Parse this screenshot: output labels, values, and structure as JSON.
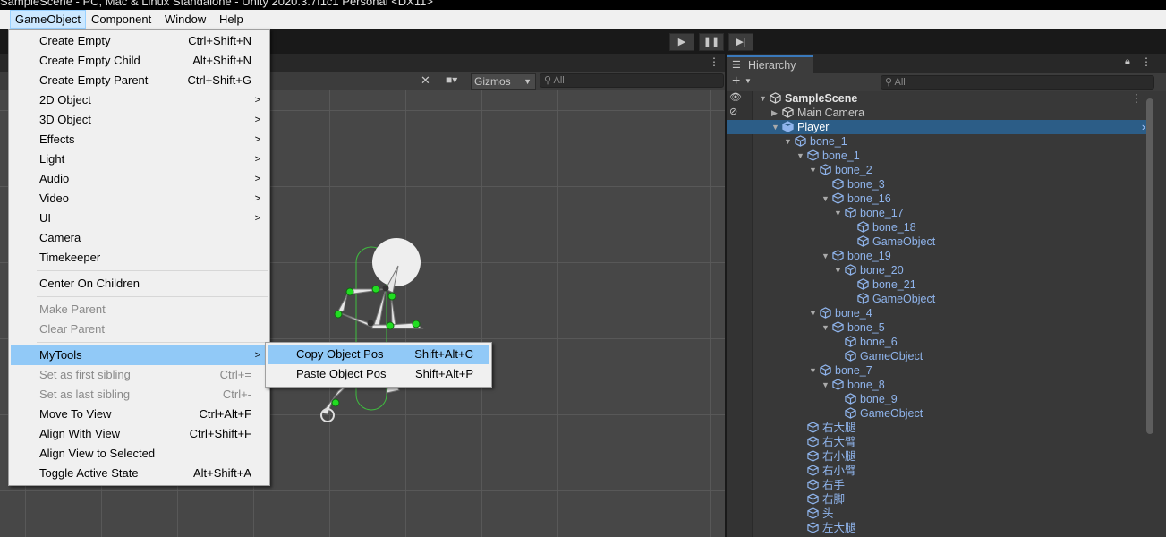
{
  "window": {
    "title": "SampleScene - PC, Mac & Linux Standalone - Unity 2020.3.7f1c1 Personal <DX11>"
  },
  "menubar": {
    "items": [
      "GameObject",
      "Component",
      "Window",
      "Help"
    ]
  },
  "toolbar": {
    "play": "▶",
    "pause": "❚❚",
    "step": "▶|"
  },
  "scene": {
    "gizmos_label": "Gizmos",
    "search_placeholder": "All"
  },
  "hierarchy": {
    "tab_label": "Hierarchy",
    "add_label": "+",
    "search_placeholder": "All",
    "rows": [
      {
        "label": "SampleScene",
        "depth": 0,
        "arrow": "down",
        "type": "scene"
      },
      {
        "label": "Main Camera",
        "depth": 1,
        "arrow": "right",
        "type": "object"
      },
      {
        "label": "Player",
        "depth": 1,
        "arrow": "down",
        "type": "prefab",
        "selected": true
      },
      {
        "label": "bone_1",
        "depth": 2,
        "arrow": "down",
        "type": "prefab"
      },
      {
        "label": "bone_1",
        "depth": 3,
        "arrow": "down",
        "type": "prefab"
      },
      {
        "label": "bone_2",
        "depth": 4,
        "arrow": "down",
        "type": "prefab"
      },
      {
        "label": "bone_3",
        "depth": 5,
        "arrow": "",
        "type": "prefab"
      },
      {
        "label": "bone_16",
        "depth": 5,
        "arrow": "down",
        "type": "prefab"
      },
      {
        "label": "bone_17",
        "depth": 6,
        "arrow": "down",
        "type": "prefab"
      },
      {
        "label": "bone_18",
        "depth": 7,
        "arrow": "",
        "type": "prefab"
      },
      {
        "label": "GameObject",
        "depth": 7,
        "arrow": "",
        "type": "prefab"
      },
      {
        "label": "bone_19",
        "depth": 5,
        "arrow": "down",
        "type": "prefab"
      },
      {
        "label": "bone_20",
        "depth": 6,
        "arrow": "down",
        "type": "prefab"
      },
      {
        "label": "bone_21",
        "depth": 7,
        "arrow": "",
        "type": "prefab"
      },
      {
        "label": "GameObject",
        "depth": 7,
        "arrow": "",
        "type": "prefab"
      },
      {
        "label": "bone_4",
        "depth": 4,
        "arrow": "down",
        "type": "prefab"
      },
      {
        "label": "bone_5",
        "depth": 5,
        "arrow": "down",
        "type": "prefab"
      },
      {
        "label": "bone_6",
        "depth": 6,
        "arrow": "",
        "type": "prefab"
      },
      {
        "label": "GameObject",
        "depth": 6,
        "arrow": "",
        "type": "prefab"
      },
      {
        "label": "bone_7",
        "depth": 4,
        "arrow": "down",
        "type": "prefab"
      },
      {
        "label": "bone_8",
        "depth": 5,
        "arrow": "down",
        "type": "prefab"
      },
      {
        "label": "bone_9",
        "depth": 6,
        "arrow": "",
        "type": "prefab"
      },
      {
        "label": "GameObject",
        "depth": 6,
        "arrow": "",
        "type": "prefab"
      },
      {
        "label": "右大腿",
        "depth": 3,
        "arrow": "",
        "type": "prefab"
      },
      {
        "label": "右大臂",
        "depth": 3,
        "arrow": "",
        "type": "prefab"
      },
      {
        "label": "右小腿",
        "depth": 3,
        "arrow": "",
        "type": "prefab"
      },
      {
        "label": "右小臂",
        "depth": 3,
        "arrow": "",
        "type": "prefab"
      },
      {
        "label": "右手",
        "depth": 3,
        "arrow": "",
        "type": "prefab"
      },
      {
        "label": "右脚",
        "depth": 3,
        "arrow": "",
        "type": "prefab"
      },
      {
        "label": "头",
        "depth": 3,
        "arrow": "",
        "type": "prefab"
      },
      {
        "label": "左大腿",
        "depth": 3,
        "arrow": "",
        "type": "prefab"
      }
    ]
  },
  "gameobject_menu": {
    "items": [
      {
        "label": "Create Empty",
        "shortcut": "Ctrl+Shift+N"
      },
      {
        "label": "Create Empty Child",
        "shortcut": "Alt+Shift+N"
      },
      {
        "label": "Create Empty Parent",
        "shortcut": "Ctrl+Shift+G"
      },
      {
        "label": "2D Object",
        "submenu": true
      },
      {
        "label": "3D Object",
        "submenu": true
      },
      {
        "label": "Effects",
        "submenu": true
      },
      {
        "label": "Light",
        "submenu": true
      },
      {
        "label": "Audio",
        "submenu": true
      },
      {
        "label": "Video",
        "submenu": true
      },
      {
        "label": "UI",
        "submenu": true
      },
      {
        "label": "Camera"
      },
      {
        "label": "Timekeeper"
      },
      {
        "separator": true
      },
      {
        "label": "Center On Children"
      },
      {
        "separator": true
      },
      {
        "label": "Make Parent",
        "disabled": true
      },
      {
        "label": "Clear Parent",
        "disabled": true
      },
      {
        "separator": true
      },
      {
        "label": "MyTools",
        "submenu": true,
        "highlighted": true
      },
      {
        "label": "Set as first sibling",
        "shortcut": "Ctrl+=",
        "disabled": true
      },
      {
        "label": "Set as last sibling",
        "shortcut": "Ctrl+-",
        "disabled": true
      },
      {
        "label": "Move To View",
        "shortcut": "Ctrl+Alt+F"
      },
      {
        "label": "Align With View",
        "shortcut": "Ctrl+Shift+F"
      },
      {
        "label": "Align View to Selected"
      },
      {
        "label": "Toggle Active State",
        "shortcut": "Alt+Shift+A"
      }
    ]
  },
  "mytools_menu": {
    "items": [
      {
        "label": "Copy Object Pos",
        "shortcut": "Shift+Alt+C",
        "highlighted": true
      },
      {
        "label": "Paste Object Pos",
        "shortcut": "Shift+Alt+P"
      }
    ]
  },
  "colors": {
    "selection": "#2c5d87",
    "prefab_text": "#8fb4ec",
    "menu_highlight": "#91c9f7",
    "joint": "#22dd22"
  }
}
